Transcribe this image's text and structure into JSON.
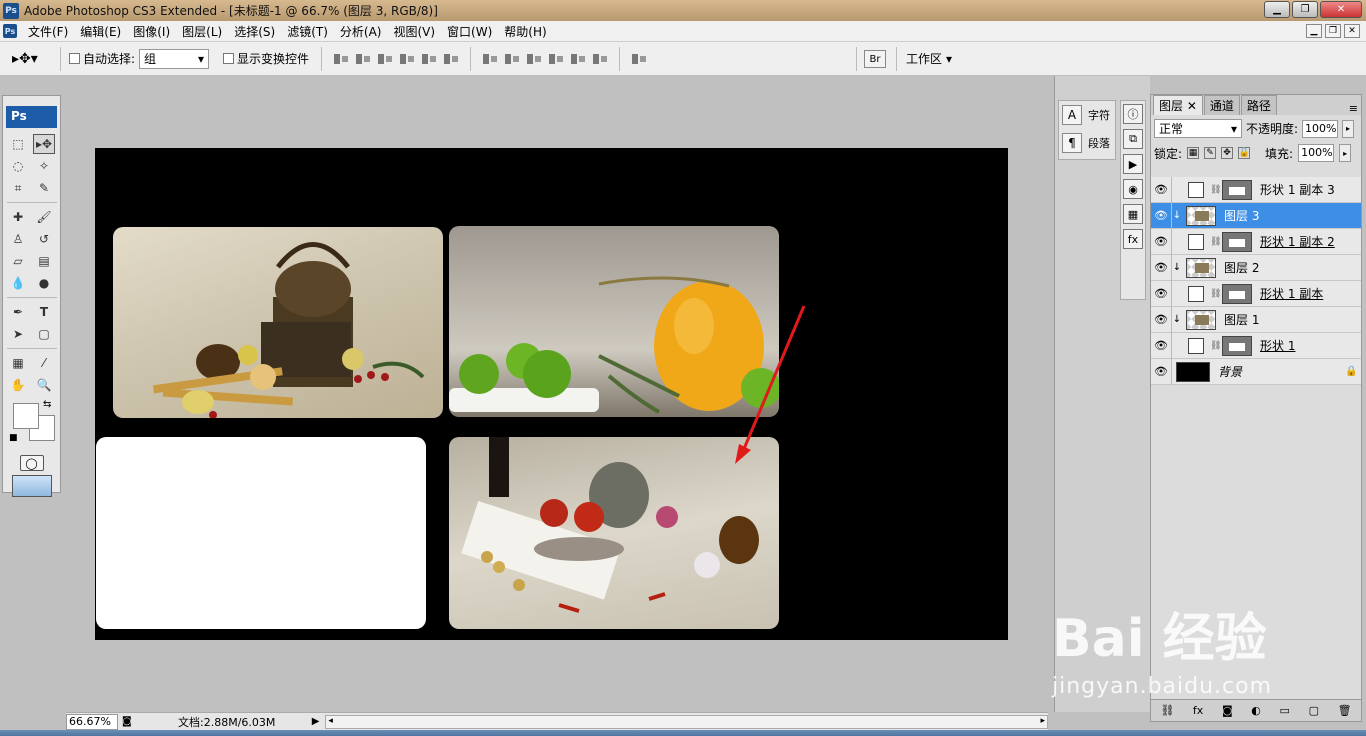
{
  "window": {
    "title": "Adobe Photoshop CS3 Extended - [未标题-1 @ 66.7% (图层 3, RGB/8)]",
    "app_icon": "Ps"
  },
  "menu": [
    "文件(F)",
    "编辑(E)",
    "图像(I)",
    "图层(L)",
    "选择(S)",
    "滤镜(T)",
    "分析(A)",
    "视图(V)",
    "窗口(W)",
    "帮助(H)"
  ],
  "options": {
    "auto_select_label": "自动选择:",
    "auto_select_value": "组",
    "show_transform_label": "显示变换控件",
    "workspace_label": "工作区"
  },
  "toolbox": {
    "logo": "Ps"
  },
  "status": {
    "zoom": "66.67%",
    "doc_size": "文档:2.88M/6.03M"
  },
  "side_panels": {
    "char_label": "字符",
    "para_label": "段落"
  },
  "layers_panel": {
    "tabs": [
      "图层",
      "通道",
      "路径"
    ],
    "blend_mode": "正常",
    "opacity_label": "不透明度:",
    "opacity_value": "100%",
    "lock_label": "锁定:",
    "fill_label": "填充:",
    "fill_value": "100%",
    "layers": [
      {
        "name": "形状 1 副本 3",
        "type": "shape",
        "selected": false
      },
      {
        "name": "图层 3",
        "type": "image",
        "selected": true
      },
      {
        "name": "形状 1 副本 2",
        "type": "shape",
        "selected": false
      },
      {
        "name": "图层 2",
        "type": "image",
        "selected": false
      },
      {
        "name": "形状 1 副本",
        "type": "shape",
        "selected": false
      },
      {
        "name": "图层 1",
        "type": "image",
        "selected": false
      },
      {
        "name": "形状 1",
        "type": "shape",
        "selected": false
      },
      {
        "name": "背景",
        "type": "background",
        "selected": false
      }
    ]
  },
  "watermark": {
    "main": "Bai 经验",
    "sub": "jingyan.baidu.com"
  }
}
